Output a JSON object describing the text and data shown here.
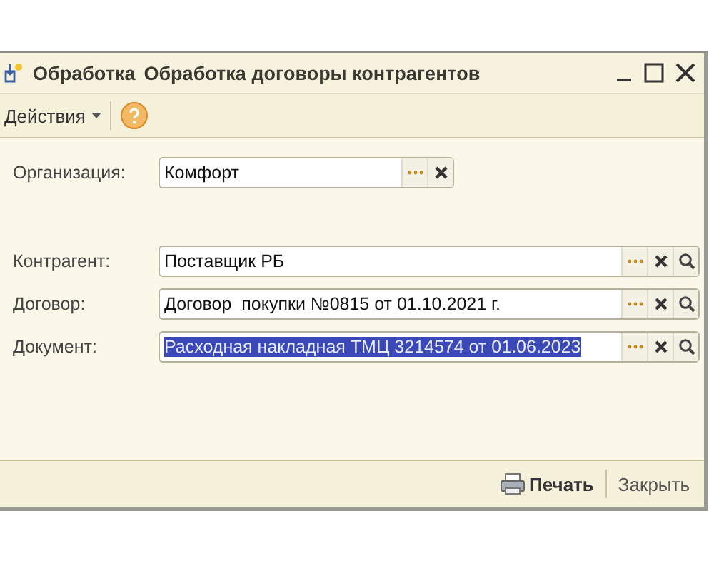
{
  "window": {
    "type_label": "Обработка",
    "title": "Обработка договоры контрагентов"
  },
  "toolbar": {
    "actions_menu": "Действия"
  },
  "organization": {
    "label": "Организация:",
    "value": "Комфорт",
    "text_selected": false,
    "buttons": [
      {
        "kind": "select"
      },
      {
        "kind": "clear"
      }
    ]
  },
  "fields": [
    {
      "label": "Контрагент:",
      "value": "Поставщик РБ",
      "text_selected": false,
      "buttons": [
        {
          "kind": "select"
        },
        {
          "kind": "clear"
        },
        {
          "kind": "search"
        }
      ]
    },
    {
      "label": "Договор:",
      "value": "Договор  покупки №0815 от 01.10.2021 г.",
      "text_selected": false,
      "buttons": [
        {
          "kind": "select"
        },
        {
          "kind": "clear"
        },
        {
          "kind": "search"
        }
      ]
    },
    {
      "label": "Документ:",
      "value": "Расходная накладная ТМЦ 3214574 от 01.06.2023",
      "text_selected": true,
      "buttons": [
        {
          "kind": "select"
        },
        {
          "kind": "clear"
        },
        {
          "kind": "search"
        }
      ]
    }
  ],
  "footer": {
    "print_button": "Печать",
    "close_button": "Закрыть"
  }
}
